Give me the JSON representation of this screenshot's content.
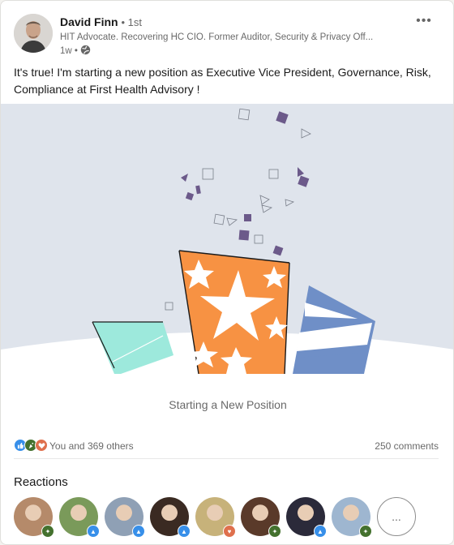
{
  "post": {
    "author_name": "David Finn",
    "degree": "• 1st",
    "headline": "HIT Advocate. Recovering HC CIO. Former Auditor, Security & Privacy Off...",
    "time": "1w •",
    "more_label": "•••",
    "text": "It's true! I'm starting a new position as Executive Vice President, Governance, Risk, Compliance at First Health Advisory !",
    "caption": "Starting a New Position",
    "reactions_text": "You and 369 others",
    "comments_text": "250 comments"
  },
  "reactions": {
    "title": "Reactions",
    "more_label": "...",
    "faces": [
      {
        "name": "reactor-1",
        "bg": "#b58a6a",
        "badge": "celebrate"
      },
      {
        "name": "reactor-2",
        "bg": "#7a9a5a",
        "badge": "like"
      },
      {
        "name": "reactor-3",
        "bg": "#8fa0b5",
        "badge": "like"
      },
      {
        "name": "reactor-4",
        "bg": "#3a2a22",
        "badge": "like"
      },
      {
        "name": "reactor-5",
        "bg": "#c7b27a",
        "badge": "love"
      },
      {
        "name": "reactor-6",
        "bg": "#5a3a2a",
        "badge": "celebrate"
      },
      {
        "name": "reactor-7",
        "bg": "#2b2a3a",
        "badge": "like"
      },
      {
        "name": "reactor-8",
        "bg": "#9eb6d0",
        "badge": "celebrate"
      }
    ]
  },
  "colors": {
    "like": "#378fe9",
    "celebrate": "#44712e",
    "love": "#df704d",
    "illustration_bg": "#dfe4ec",
    "confetti": "#6c5a8a",
    "gift_orange": "#f79243",
    "gift_teal": "#9de9dc",
    "gift_blue": "#6f8fc7"
  },
  "icons": {
    "globe": "globe-icon",
    "overflow": "overflow-menu-icon"
  }
}
